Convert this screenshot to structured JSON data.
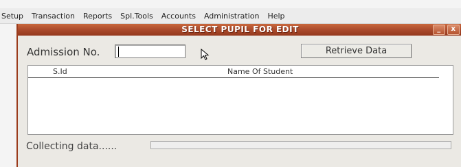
{
  "menu": {
    "items": [
      "Setup",
      "Transaction",
      "Reports",
      "Spl.Tools",
      "Accounts",
      "Administration",
      "Help"
    ]
  },
  "window": {
    "title": "SELECT PUPIL FOR EDIT",
    "minimize_glyph": "_",
    "close_glyph": "x"
  },
  "form": {
    "admission_label": "Admission No.",
    "admission_value": "",
    "retrieve_label": "Retrieve Data"
  },
  "list": {
    "columns": [
      "S.Id",
      "Name Of Student"
    ],
    "rows": []
  },
  "status": {
    "text": "Collecting data......",
    "progress": 0
  }
}
